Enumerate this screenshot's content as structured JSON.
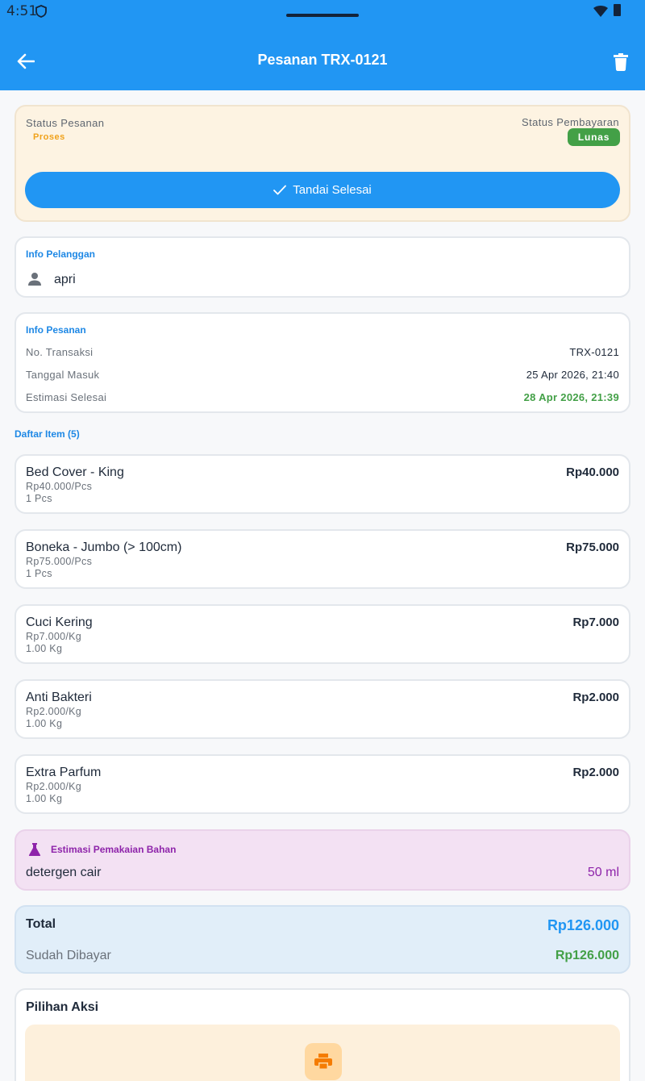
{
  "status_bar": {
    "time": "4:51"
  },
  "app_bar": {
    "title": "Pesanan TRX-0121"
  },
  "status": {
    "order_label": "Status Pesanan",
    "order_value": "Proses",
    "payment_label": "Status Pembayaran",
    "payment_value": "Lunas",
    "complete_button": "Tandai Selesai"
  },
  "customer": {
    "section_title": "Info Pelanggan",
    "name": "apri"
  },
  "order_info": {
    "section_title": "Info Pesanan",
    "rows": [
      {
        "label": "No. Transaksi",
        "value": "TRX-0121"
      },
      {
        "label": "Tanggal Masuk",
        "value": "25 Apr 2026, 21:40"
      },
      {
        "label": "Estimasi Selesai",
        "value": "28 Apr 2026, 21:39"
      }
    ]
  },
  "items": {
    "title": "Daftar Item (5)",
    "list": [
      {
        "name": "Bed Cover - King",
        "unit_price": "Rp40.000/Pcs",
        "qty": "1 Pcs",
        "price": "Rp40.000"
      },
      {
        "name": "Boneka - Jumbo (> 100cm)",
        "unit_price": "Rp75.000/Pcs",
        "qty": "1 Pcs",
        "price": "Rp75.000"
      },
      {
        "name": "Cuci Kering",
        "unit_price": "Rp7.000/Kg",
        "qty": "1.00 Kg",
        "price": "Rp7.000"
      },
      {
        "name": "Anti Bakteri",
        "unit_price": "Rp2.000/Kg",
        "qty": "1.00 Kg",
        "price": "Rp2.000"
      },
      {
        "name": "Extra Parfum",
        "unit_price": "Rp2.000/Kg",
        "qty": "1.00 Kg",
        "price": "Rp2.000"
      }
    ]
  },
  "material": {
    "title": "Estimasi Pemakaian Bahan",
    "name": "detergen cair",
    "qty": "50 ml"
  },
  "totals": {
    "total_label": "Total",
    "total_value": "Rp126.000",
    "paid_label": "Sudah Dibayar",
    "paid_value": "Rp126.000"
  },
  "actions": {
    "title": "Pilihan Aksi"
  },
  "icons": {
    "back": "arrow-left-icon",
    "delete": "trash-icon",
    "check": "check-icon",
    "person": "person-icon",
    "flask": "flask-icon",
    "print": "printer-icon"
  },
  "colors": {
    "primary": "#2196F3",
    "success": "#43a047",
    "warning": "#f0a21b",
    "purple": "#8e24aa",
    "status_bg": "#fdf3e2",
    "material_bg": "#f3e1f3",
    "total_bg": "#e1eef9"
  }
}
